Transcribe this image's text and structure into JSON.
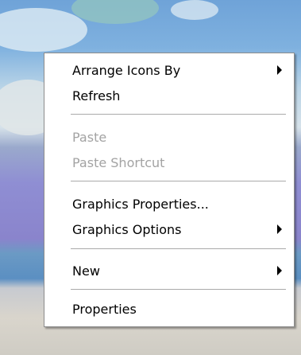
{
  "context_menu": {
    "items": [
      {
        "label": "Arrange Icons By",
        "submenu": true,
        "disabled": false
      },
      {
        "label": "Refresh",
        "submenu": false,
        "disabled": false
      },
      {
        "label": "Paste",
        "submenu": false,
        "disabled": true
      },
      {
        "label": "Paste Shortcut",
        "submenu": false,
        "disabled": true
      },
      {
        "label": "Graphics Properties...",
        "submenu": false,
        "disabled": false
      },
      {
        "label": "Graphics Options",
        "submenu": true,
        "disabled": false
      },
      {
        "label": "New",
        "submenu": true,
        "disabled": false
      },
      {
        "label": "Properties",
        "submenu": false,
        "disabled": false
      }
    ]
  },
  "colors": {
    "menu_background": "#ffffff",
    "menu_border": "#8c8c8c",
    "disabled_text": "#a3a3a3",
    "separator": "#aaaaaa"
  }
}
